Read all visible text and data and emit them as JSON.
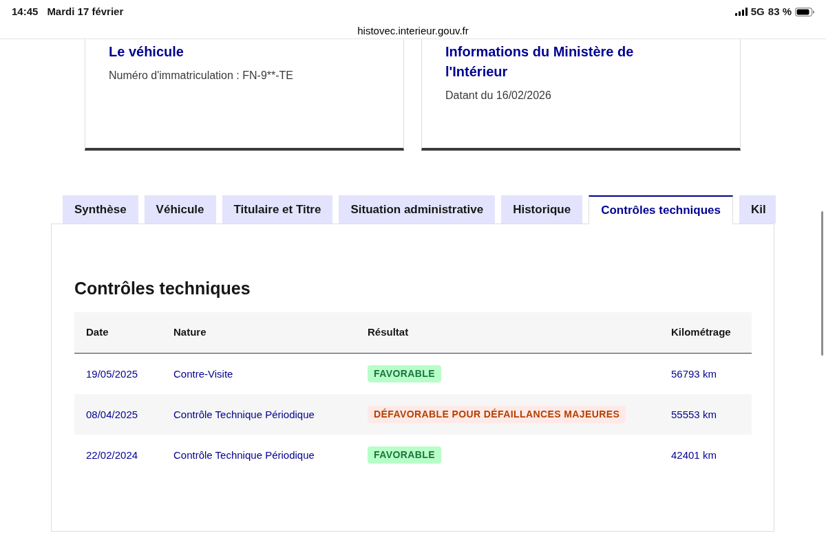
{
  "status_bar": {
    "time": "14:45",
    "date": "Mardi 17 février",
    "network": "5G",
    "battery": "83 %"
  },
  "address_bar": {
    "url": "histovec.interieur.gouv.fr"
  },
  "cards": [
    {
      "title": "Le véhicule",
      "text": "Numéro d'immatriculation : FN-9**-TE"
    },
    {
      "title": "Informations du Ministère de l'Intérieur",
      "text": "Datant du 16/02/2026"
    }
  ],
  "tabs": [
    {
      "label": "Synthèse",
      "selected": false
    },
    {
      "label": "Véhicule",
      "selected": false
    },
    {
      "label": "Titulaire et Titre",
      "selected": false
    },
    {
      "label": "Situation administrative",
      "selected": false
    },
    {
      "label": "Historique",
      "selected": false
    },
    {
      "label": "Contrôles techniques",
      "selected": true
    },
    {
      "label": "Kil",
      "selected": false
    }
  ],
  "panel": {
    "heading": "Contrôles techniques",
    "table": {
      "columns": [
        "Date",
        "Nature",
        "Résultat",
        "Kilométrage"
      ],
      "rows": [
        {
          "date": "19/05/2025",
          "nature": "Contre-Visite",
          "result": {
            "text": "FAVORABLE",
            "kind": "favorable"
          },
          "mileage": "56793 km"
        },
        {
          "date": "08/04/2025",
          "nature": "Contrôle Technique Périodique",
          "result": {
            "text": "DÉFAVORABLE POUR DÉFAILLANCES MAJEURES",
            "kind": "unfavorable"
          },
          "mileage": "55553 km"
        },
        {
          "date": "22/02/2024",
          "nature": "Contrôle Technique Périodique",
          "result": {
            "text": "FAVORABLE",
            "kind": "favorable"
          },
          "mileage": "42401 km"
        }
      ]
    }
  }
}
